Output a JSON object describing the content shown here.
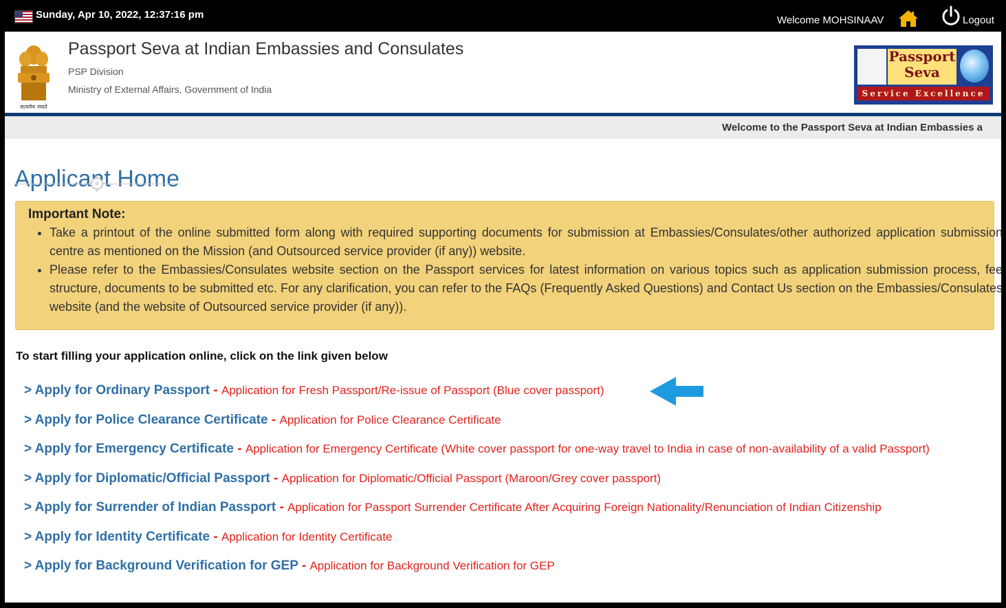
{
  "topbar": {
    "datetime": "Sunday, Apr 10, 2022, 12:37:16 pm",
    "welcome": "Welcome MOHSINAAV",
    "logout": "Logout"
  },
  "header": {
    "title": "Passport Seva at Indian Embassies and Consulates",
    "division": "PSP Division",
    "ministry": "Ministry of External Affairs, Government of India",
    "emblem_motto": "सत्यमेव जयते",
    "logo_line1": "Passport",
    "logo_line2": "Seva",
    "logo_tagline": "Service Excellence"
  },
  "marquee": "Welcome to the Passport Seva at Indian Embassies a",
  "page_heading": "Applicant Home",
  "note": {
    "title": "Important Note:",
    "items": [
      "Take a printout of the online submitted form along with required supporting documents for submission at Embassies/Consulates/other authorized application submission centre as mentioned on the Mission (and Outsourced service provider (if any)) website.",
      "Please refer to the Embassies/Consulates website section on the Passport services for latest information on various topics such as application submission process, fee structure, documents to be submitted etc. For any clarification, you can refer to the FAQs (Frequently Asked Questions) and Contact Us section on the Embassies/Consulates website (and the website of Outsourced service provider (if any))."
    ]
  },
  "intro": "To start filling your application online, click on the link given below",
  "links": [
    {
      "label": "> Apply for Ordinary Passport",
      "desc": "Application for Fresh Passport/Re-issue of Passport (Blue cover passport)"
    },
    {
      "label": "> Apply for Police Clearance Certificate",
      "desc": "Application for Police Clearance Certificate"
    },
    {
      "label": "> Apply for Emergency Certificate",
      "desc": "Application for Emergency Certificate (White cover passport for one-way travel to India in case of non-availability of a valid Passport)"
    },
    {
      "label": "> Apply for Diplomatic/Official Passport",
      "desc": "Application for Diplomatic/Official Passport (Maroon/Grey cover passport)"
    },
    {
      "label": "> Apply for Surrender of Indian Passport",
      "desc": "Application for Passport Surrender Certificate After Acquiring Foreign Nationality/Renunciation of Indian Citizenship"
    },
    {
      "label": "> Apply for Identity Certificate",
      "desc": "Application for Identity Certificate"
    },
    {
      "label": "> Apply for Background Verification for GEP",
      "desc": "Application for Background Verification for GEP"
    }
  ],
  "separator": " - ",
  "colors": {
    "link_blue": "#2f6fa6",
    "desc_red": "#e0231d",
    "note_bg": "#f2d27b",
    "header_rule": "#0b3d73",
    "arrow": "#1e9be0"
  },
  "icons": [
    "us-flag-icon",
    "home-icon",
    "power-icon",
    "national-emblem-icon",
    "passport-seva-logo",
    "blue-arrow-icon"
  ]
}
